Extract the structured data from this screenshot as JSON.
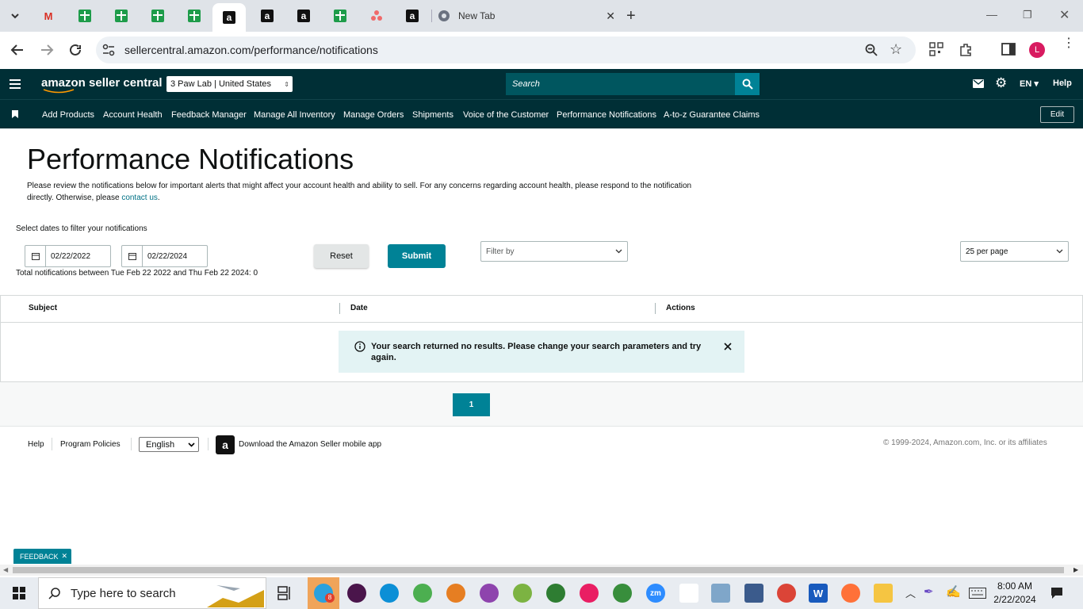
{
  "browser": {
    "new_tab_label": "New Tab",
    "url": "sellercentral.amazon.com/performance/notifications",
    "profile_initial": "L"
  },
  "header": {
    "logo_text": "amazon seller central",
    "account_selector": "3 Paw Lab | United States",
    "search_placeholder": "Search",
    "language": "EN",
    "help": "Help"
  },
  "nav": {
    "items": [
      "Add Products",
      "Account Health",
      "Feedback Manager",
      "Manage All Inventory",
      "Manage Orders",
      "Shipments",
      "Voice of the Customer",
      "Performance Notifications",
      "A-to-z Guarantee Claims"
    ],
    "edit": "Edit"
  },
  "page": {
    "title": "Performance Notifications",
    "intro_1": "Please review the notifications below for important alerts that might affect your account health and ability to sell. For any concerns regarding account health, please respond to the notification directly. Otherwise, please ",
    "intro_link": "contact us",
    "intro_end": "."
  },
  "filters": {
    "date_label": "Select dates to filter your notifications",
    "start_date": "02/22/2022",
    "end_date": "02/22/2024",
    "reset": "Reset",
    "submit": "Submit",
    "filter_by": "Filter by",
    "per_page": "25 per page",
    "total_text": "Total notifications between Tue Feb 22 2022 and Thu Feb 22 2024: 0"
  },
  "table": {
    "columns": [
      "Subject",
      "Date",
      "Actions"
    ],
    "alert_message": "Your search returned no results. Please change your search parameters and try again."
  },
  "pagination": {
    "current_page": "1"
  },
  "footer": {
    "help": "Help",
    "program_policies": "Program Policies",
    "language": "English",
    "download_app": "Download the Amazon Seller mobile app",
    "copyright": "© 1999-2024, Amazon.com, Inc. or its affiliates"
  },
  "feedback_tab": "FEEDBACK",
  "taskbar": {
    "search_placeholder": "Type here to search",
    "time": "8:00 AM",
    "date": "2/22/2024",
    "badge": "8"
  },
  "colors": {
    "nav_bg": "#002f36",
    "accent": "#008296",
    "alert_bg": "#e3f3f4"
  }
}
